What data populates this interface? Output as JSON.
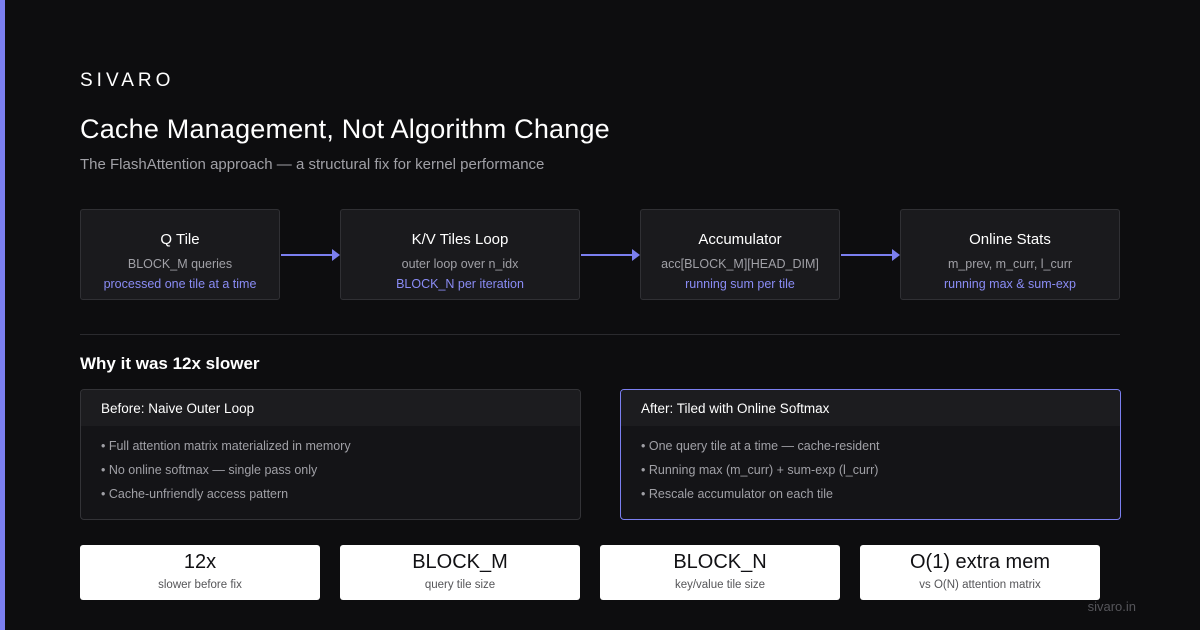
{
  "brand": "SIVARO",
  "title": "Cache Management, Not Algorithm Change",
  "subtitle": "The FlashAttention approach — a structural fix for kernel performance",
  "flow": [
    {
      "title": "Q Tile",
      "line1": "BLOCK_M queries",
      "line2": "processed one tile at a time"
    },
    {
      "title": "K/V Tiles Loop",
      "line1": "outer loop over n_idx",
      "line2": "BLOCK_N per iteration"
    },
    {
      "title": "Accumulator",
      "line1": "acc[BLOCK_M][HEAD_DIM]",
      "line2": "running sum per tile"
    },
    {
      "title": "Online Stats",
      "line1": "m_prev, m_curr, l_curr",
      "line2": "running max & sum-exp"
    }
  ],
  "section_heading": "Why it was 12x slower",
  "before": {
    "heading": "Before: Naive Outer Loop",
    "items": [
      "• Full attention matrix materialized in memory",
      "• No online softmax — single pass only",
      "• Cache-unfriendly access pattern"
    ]
  },
  "after": {
    "heading": "After: Tiled with Online Softmax",
    "items": [
      "• One query tile at a time — cache-resident",
      "• Running max (m_curr) + sum-exp (l_curr)",
      "• Rescale accumulator on each tile"
    ]
  },
  "stats": [
    {
      "value": "12x",
      "label": "slower before fix"
    },
    {
      "value": "BLOCK_M",
      "label": "query tile size"
    },
    {
      "value": "BLOCK_N",
      "label": "key/value tile size"
    },
    {
      "value": "O(1) extra mem",
      "label": "vs O(N) attention matrix"
    }
  ],
  "footer": "sivaro.in",
  "colors": {
    "accent": "#7b7ff0",
    "background": "#0d0d0f"
  }
}
